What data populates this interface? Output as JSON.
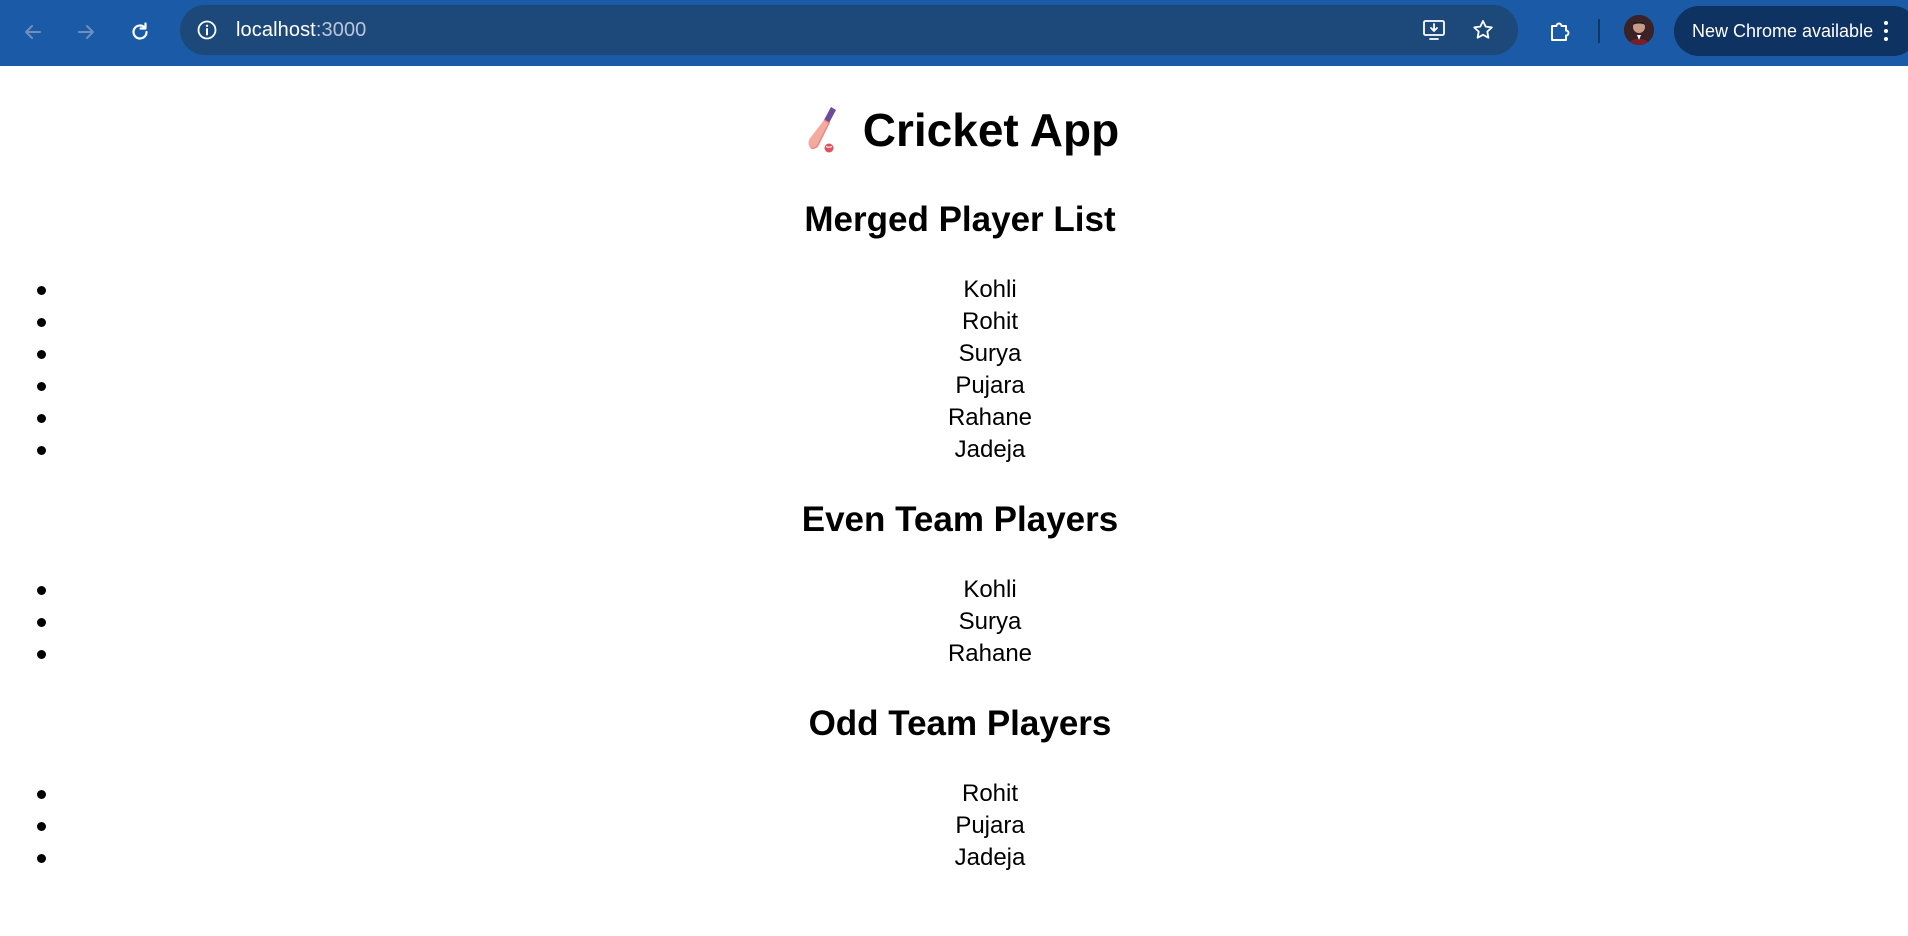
{
  "browser": {
    "url_host": "localhost",
    "url_port": ":3000",
    "update_label": "New Chrome available",
    "colors": {
      "toolbar": "#1b5aa6",
      "omnibox": "#1d487a",
      "update_chip": "#0e3262"
    }
  },
  "page": {
    "title": "Cricket App",
    "title_icon": "cricket-bat-icon",
    "sections": [
      {
        "heading": "Merged Player List",
        "players": [
          "Kohli",
          "Rohit",
          "Surya",
          "Pujara",
          "Rahane",
          "Jadeja"
        ]
      },
      {
        "heading": "Even Team Players",
        "players": [
          "Kohli",
          "Surya",
          "Rahane"
        ]
      },
      {
        "heading": "Odd Team Players",
        "players": [
          "Rohit",
          "Pujara",
          "Jadeja"
        ]
      }
    ]
  }
}
